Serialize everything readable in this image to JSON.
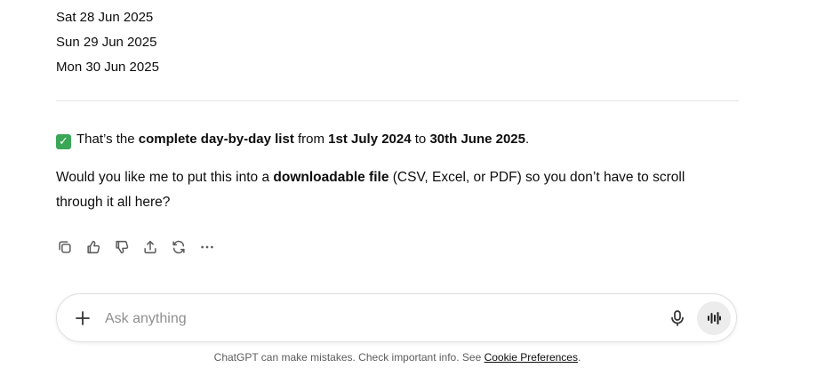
{
  "dates": [
    "Sat 28 Jun 2025",
    "Sun 29 Jun 2025",
    "Mon 30 Jun 2025"
  ],
  "summary": {
    "check_icon": "check-mark-button-icon",
    "p1": "That’s the ",
    "b1": "complete day-by-day list",
    "p2": " from ",
    "b2": "1st July 2024",
    "p3": " to ",
    "b3": "30th June 2025",
    "p4": "."
  },
  "question": {
    "p1": "Would you like me to put this into a ",
    "b1": "downloadable file",
    "p2": " (CSV, Excel, or PDF) so you don’t have to scroll through it all here?"
  },
  "actions": [
    "copy-icon",
    "thumbs-up-icon",
    "thumbs-down-icon",
    "share-icon",
    "regenerate-icon",
    "more-icon"
  ],
  "composer": {
    "placeholder": "Ask anything",
    "value": ""
  },
  "footer": {
    "text": "ChatGPT can make mistakes. Check important info. See ",
    "link": "Cookie Preferences",
    "end": "."
  },
  "colors": {
    "check_bg": "#3aa757",
    "divider": "#e3e3e3",
    "voice_bg": "#ececec"
  }
}
